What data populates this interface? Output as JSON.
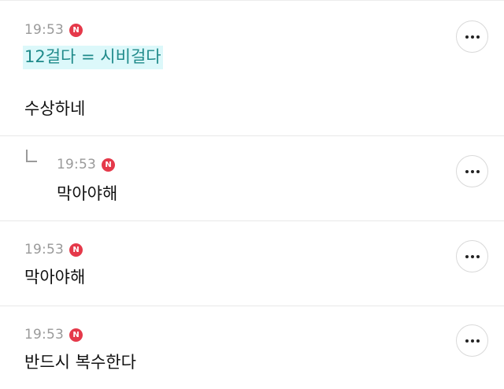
{
  "comments": [
    {
      "time": "19:53",
      "badge": "N",
      "highlight_text": "12걸다 = 시비걸다",
      "text": "수상하네",
      "more_label": "more-options"
    },
    {
      "time": "19:53",
      "badge": "N",
      "text": "막아야해",
      "more_label": "more-options"
    },
    {
      "time": "19:53",
      "badge": "N",
      "text": "막아야해",
      "more_label": "more-options"
    },
    {
      "time": "19:53",
      "badge": "N",
      "text": "반드시 복수한다",
      "more_label": "more-options"
    }
  ],
  "colors": {
    "badge": "#e5394a",
    "highlight_bg": "#dcf8fa",
    "highlight_text": "#1f8a8a",
    "timestamp": "#9a9a9a"
  },
  "icons": [
    "new-badge-icon",
    "more-dots-icon",
    "reply-arrow-icon"
  ]
}
